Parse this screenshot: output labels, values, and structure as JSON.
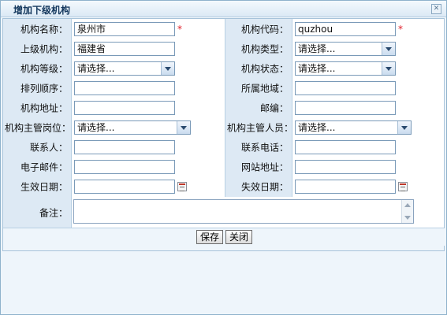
{
  "dialog": {
    "title": "增加下级机构",
    "close_symbol": "✕"
  },
  "form": {
    "org_name": {
      "label": "机构名称：",
      "value": "泉州市",
      "required": "*"
    },
    "org_code": {
      "label": "机构代码：",
      "value": "quzhou",
      "required": "*"
    },
    "parent_org": {
      "label": "上级机构：",
      "value": "福建省"
    },
    "org_type": {
      "label": "机构类型：",
      "selected": "请选择..."
    },
    "org_level": {
      "label": "机构等级：",
      "selected": "请选择..."
    },
    "org_status": {
      "label": "机构状态：",
      "selected": "请选择..."
    },
    "sort_order": {
      "label": "排列顺序：",
      "value": ""
    },
    "region": {
      "label": "所属地域：",
      "value": ""
    },
    "address": {
      "label": "机构地址：",
      "value": ""
    },
    "postcode": {
      "label": "邮编：",
      "value": ""
    },
    "manager_post": {
      "label": "机构主管岗位：",
      "selected": "请选择..."
    },
    "manager_person": {
      "label": "机构主管人员：",
      "selected": "请选择..."
    },
    "contact": {
      "label": "联系人：",
      "value": ""
    },
    "phone": {
      "label": "联系电话：",
      "value": ""
    },
    "email": {
      "label": "电子邮件：",
      "value": ""
    },
    "website": {
      "label": "网站地址：",
      "value": ""
    },
    "effective_date": {
      "label": "生效日期：",
      "value": ""
    },
    "expiry_date": {
      "label": "失效日期：",
      "value": ""
    },
    "notes": {
      "label": "备注：",
      "value": ""
    }
  },
  "buttons": {
    "save": "保存",
    "close": "关闭"
  },
  "icons": {
    "select_arrow": "chevron-down-icon",
    "date_picker": "calendar-icon",
    "close": "close-icon"
  }
}
